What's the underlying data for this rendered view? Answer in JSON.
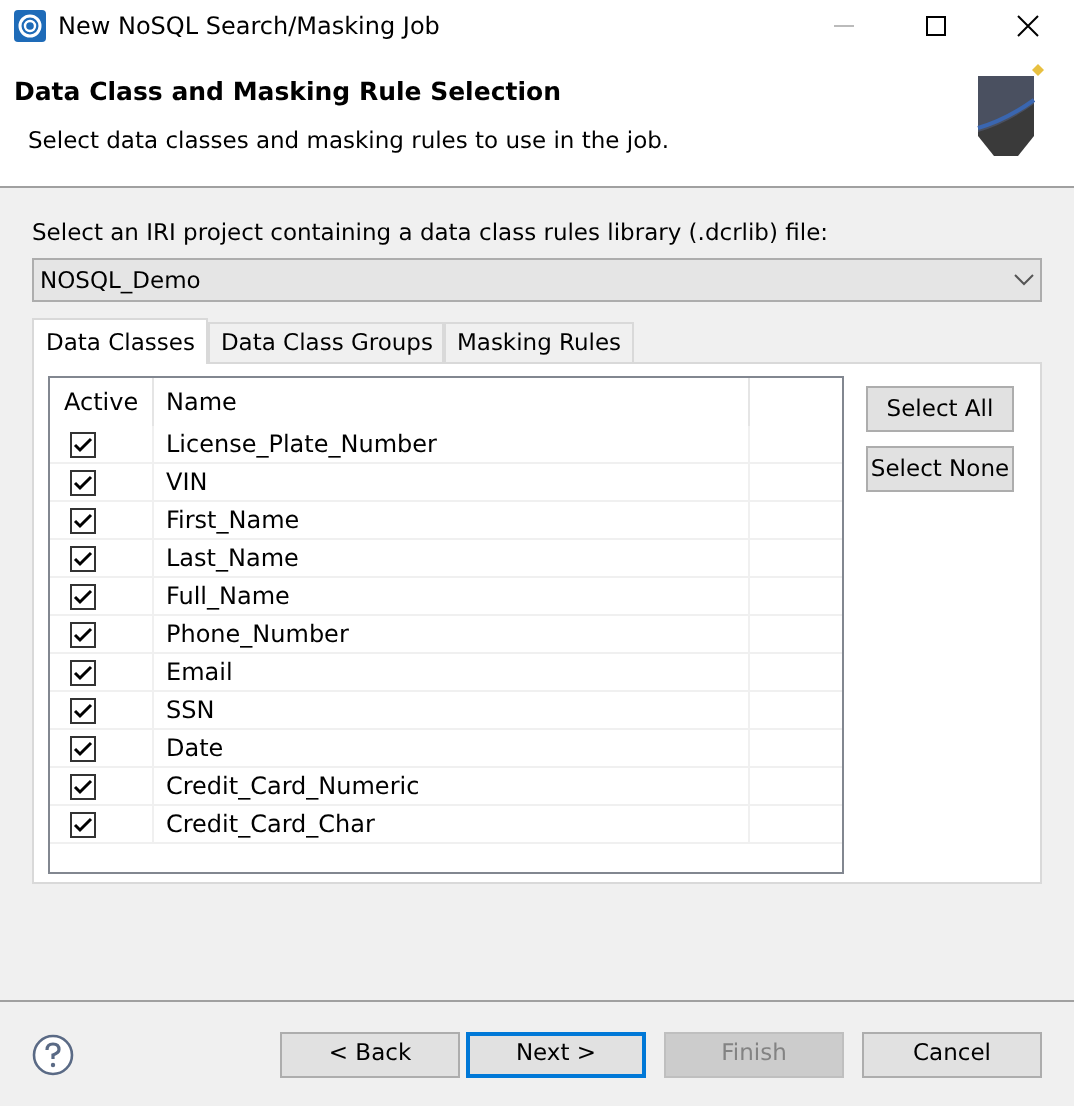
{
  "window": {
    "title": "New NoSQL Search/Masking Job"
  },
  "header": {
    "title": "Data Class and Masking Rule Selection",
    "description": "Select data classes and masking rules to use in the job."
  },
  "project": {
    "label": "Select an IRI project containing a data class rules library (.dcrlib) file:",
    "value": "NOSQL_Demo"
  },
  "tabs": [
    {
      "label": "Data Classes",
      "selected": true
    },
    {
      "label": "Data Class Groups",
      "selected": false
    },
    {
      "label": "Masking Rules",
      "selected": false
    }
  ],
  "table": {
    "columns": [
      "Active",
      "Name"
    ],
    "rows": [
      {
        "name": "License_Plate_Number",
        "checked": true
      },
      {
        "name": "VIN",
        "checked": true
      },
      {
        "name": "First_Name",
        "checked": true
      },
      {
        "name": "Last_Name",
        "checked": true
      },
      {
        "name": "Full_Name",
        "checked": true
      },
      {
        "name": "Phone_Number",
        "checked": true
      },
      {
        "name": "Email",
        "checked": true
      },
      {
        "name": "SSN",
        "checked": true
      },
      {
        "name": "Date",
        "checked": true
      },
      {
        "name": "Credit_Card_Numeric",
        "checked": true
      },
      {
        "name": "Credit_Card_Char",
        "checked": true
      }
    ]
  },
  "side_buttons": [
    "Select All",
    "Select None"
  ],
  "footer_buttons": [
    {
      "label": "< Back",
      "disabled": false,
      "focused": false
    },
    {
      "label": "Next >",
      "disabled": false,
      "focused": true
    },
    {
      "label": "Finish",
      "disabled": true,
      "focused": false
    },
    {
      "label": "Cancel",
      "disabled": false,
      "focused": false
    }
  ]
}
